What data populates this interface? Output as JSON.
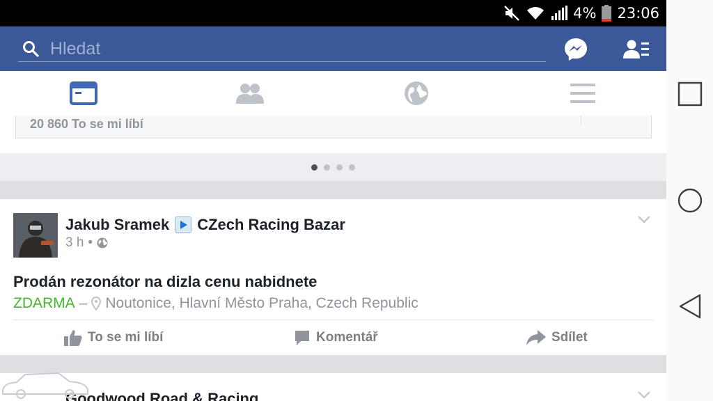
{
  "status_bar": {
    "battery": "4%",
    "time": "23:06"
  },
  "header": {
    "search_placeholder": "Hledat"
  },
  "tabs": [
    "news-feed",
    "friends",
    "notifications",
    "menu"
  ],
  "page_card": {
    "likes": "20 860 To se mi líbí"
  },
  "carousel": {
    "pages": 4,
    "active": 1
  },
  "post": {
    "author": "Jakub Sramek",
    "group": "CZech Racing Bazar",
    "time": "3 h",
    "separator": "•",
    "title": "Prodán rezonátor na dizla cenu nabidnete",
    "price": "ZDARMA",
    "dash": "–",
    "location": "Noutonice, Hlavní Město Praha, Czech Republic",
    "actions": {
      "like": "To se mi líbí",
      "comment": "Komentář",
      "share": "Sdílet"
    }
  },
  "post2": {
    "author": "Goodwood Road & Racing"
  },
  "colors": {
    "header": "#3b5998",
    "price": "#42b72a",
    "active_tab": "#4267b2"
  }
}
